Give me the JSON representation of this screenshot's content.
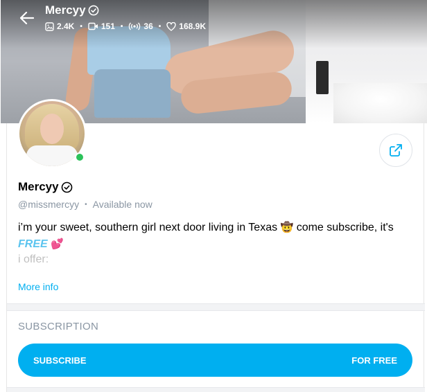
{
  "topbar": {
    "name": "Mercyy",
    "stats": {
      "photos": "2.4K",
      "videos": "151",
      "streams": "36",
      "likes": "168.9K"
    }
  },
  "profile": {
    "name": "Mercyy",
    "handle": "@missmercyy",
    "status": "Available now",
    "online": true,
    "bio": {
      "line1_text": "i’m your sweet, southern girl next door living in Texas",
      "line1_emoji": "🤠",
      "line1_tail": "come subscribe, it's",
      "free_word": "FREE",
      "free_emoji": "💕",
      "line3": "i offer:",
      "line4": "..."
    },
    "more_info": "More info"
  },
  "subscription": {
    "title": "SUBSCRIPTION",
    "button_left": "SUBSCRIBE",
    "button_right": "FOR FREE"
  },
  "colors": {
    "accent": "#00aff0",
    "free": "#5bc4ef",
    "online": "#2bc25a",
    "muted": "#8a96a3"
  },
  "icons": {
    "back": "arrow-left-icon",
    "verified": "verified-badge-icon",
    "photos": "image-icon",
    "videos": "video-icon",
    "streams": "broadcast-icon",
    "likes": "heart-icon",
    "share": "share-icon"
  }
}
